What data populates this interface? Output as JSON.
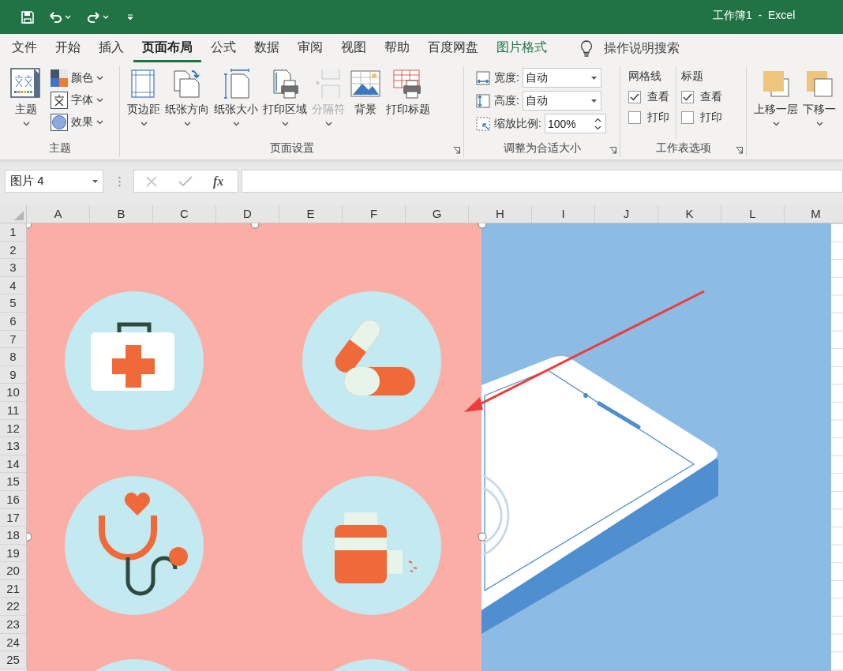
{
  "title_bar": {
    "title": "工作簿1  -  Excel"
  },
  "tabs": [
    {
      "label": "文件",
      "selected": false,
      "kind": "normal"
    },
    {
      "label": "开始",
      "selected": false,
      "kind": "normal"
    },
    {
      "label": "插入",
      "selected": false,
      "kind": "normal"
    },
    {
      "label": "页面布局",
      "selected": true,
      "kind": "normal"
    },
    {
      "label": "公式",
      "selected": false,
      "kind": "normal"
    },
    {
      "label": "数据",
      "selected": false,
      "kind": "normal"
    },
    {
      "label": "审阅",
      "selected": false,
      "kind": "normal"
    },
    {
      "label": "视图",
      "selected": false,
      "kind": "normal"
    },
    {
      "label": "帮助",
      "selected": false,
      "kind": "normal"
    },
    {
      "label": "百度网盘",
      "selected": false,
      "kind": "normal"
    },
    {
      "label": "图片格式",
      "selected": false,
      "kind": "contextual"
    }
  ],
  "tell_me": {
    "placeholder": "操作说明搜索"
  },
  "groups": [
    {
      "kind": "themes",
      "label": "主题",
      "big": {
        "label": "主题"
      },
      "small": [
        {
          "label": "颜色",
          "kind": "colors"
        },
        {
          "label": "字体",
          "kind": "fonts"
        },
        {
          "label": "效果",
          "kind": "effects"
        }
      ]
    },
    {
      "kind": "buttons",
      "label": "页面设置",
      "launcher": true,
      "buttons": [
        {
          "label": "页边距",
          "kind": "margins",
          "caret": true,
          "disabled": false
        },
        {
          "label": "纸张方向",
          "kind": "orientation",
          "caret": true,
          "disabled": false
        },
        {
          "label": "纸张大小",
          "kind": "size",
          "caret": true,
          "disabled": false
        },
        {
          "label": "打印区域",
          "kind": "print-area",
          "caret": true,
          "disabled": false
        },
        {
          "label": "分隔符",
          "kind": "breaks",
          "caret": true,
          "disabled": true
        },
        {
          "label": "背景",
          "kind": "background",
          "disabled": false
        },
        {
          "label": "打印标题",
          "kind": "print-titles",
          "disabled": false
        }
      ]
    },
    {
      "kind": "scale",
      "label": "调整为合适大小",
      "launcher": true,
      "fields": [
        {
          "label": "宽度:",
          "value": "自动",
          "kind": "dropdown"
        },
        {
          "label": "高度:",
          "value": "自动",
          "kind": "dropdown"
        },
        {
          "label": "缩放比例:",
          "value": "100%",
          "kind": "spinner"
        }
      ]
    },
    {
      "kind": "options",
      "label": "工作表选项",
      "launcher": true,
      "columns": [
        {
          "heading": "网格线",
          "options": [
            {
              "label": "查看",
              "checked": true
            },
            {
              "label": "打印",
              "checked": false
            }
          ]
        },
        {
          "heading": "标题",
          "options": [
            {
              "label": "查看",
              "checked": true
            },
            {
              "label": "打印",
              "checked": false
            }
          ]
        }
      ]
    },
    {
      "kind": "buttons",
      "buttons": [
        {
          "label": "上移一层",
          "kind": "bring-forward",
          "caret": true,
          "disabled": false
        },
        {
          "label": "下移一",
          "kind": "send-backward",
          "caret": true,
          "disabled": false
        }
      ]
    }
  ],
  "formula_bar": {
    "name_box": "图片 4",
    "function_label": "fx"
  },
  "columns": [
    "A",
    "B",
    "C",
    "D",
    "E",
    "F",
    "G",
    "H",
    "I",
    "J",
    "K",
    "L",
    "M"
  ],
  "rows": [
    "1",
    "2",
    "3",
    "4",
    "5",
    "6",
    "7",
    "8",
    "9",
    "10",
    "11",
    "12",
    "13",
    "14",
    "15",
    "16",
    "17",
    "18",
    "19",
    "20",
    "21",
    "22",
    "23",
    "24",
    "25"
  ]
}
